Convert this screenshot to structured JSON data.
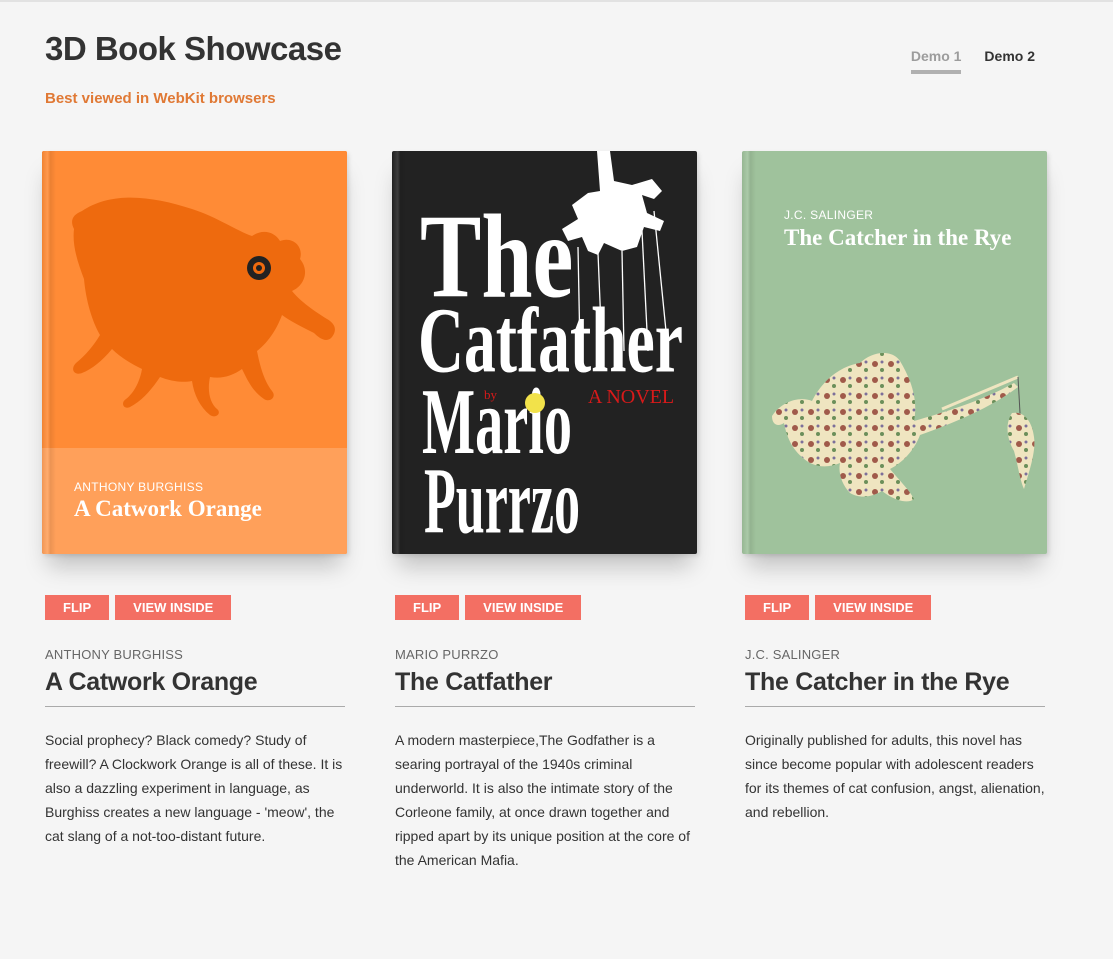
{
  "header": {
    "title": "3D Book Showcase",
    "subtitle": "Best viewed in WebKit browsers",
    "nav": [
      {
        "label": "Demo 1",
        "active": true
      },
      {
        "label": "Demo 2",
        "active": false
      }
    ]
  },
  "books": [
    {
      "cover_author": "ANTHONY BURGHISS",
      "cover_title": "A Catwork Orange",
      "color": "#ff8a34",
      "flip_label": "FLIP",
      "inside_label": "VIEW INSIDE",
      "author": "ANTHONY BURGHISS",
      "title": "A Catwork Orange",
      "description": "Social prophecy? Black comedy? Study of freewill? A Clockwork Orange is all of these. It is also a dazzling experiment in language, as Burghiss creates a new language - 'meow', the cat slang of a not-too-distant future."
    },
    {
      "cover_lines": [
        "The",
        "Catfather",
        "Mario",
        "Purrzo"
      ],
      "cover_by": "by",
      "cover_novel": "A NOVEL",
      "color": "#222222",
      "flip_label": "FLIP",
      "inside_label": "VIEW INSIDE",
      "author": "MARIO PURRZO",
      "title": "The Catfather",
      "description": "A modern masterpiece,The Godfather is a searing portrayal of the 1940s criminal underworld. It is also the intimate story of the Corleone family, at once drawn together and ripped apart by its unique position at the core of the American Mafia."
    },
    {
      "cover_author": "J.C. SALINGER",
      "cover_title": "The Catcher in the Rye",
      "color": "#9fc29c",
      "flip_label": "FLIP",
      "inside_label": "VIEW INSIDE",
      "author": "J.C. SALINGER",
      "title": "The Catcher in the Rye",
      "description": "Originally published for adults, this novel has since become popular with adolescent readers for its themes of cat confusion, angst, alienation, and rebellion."
    }
  ],
  "colors": {
    "accent": "#f36f63",
    "subtitle": "#e07935"
  }
}
